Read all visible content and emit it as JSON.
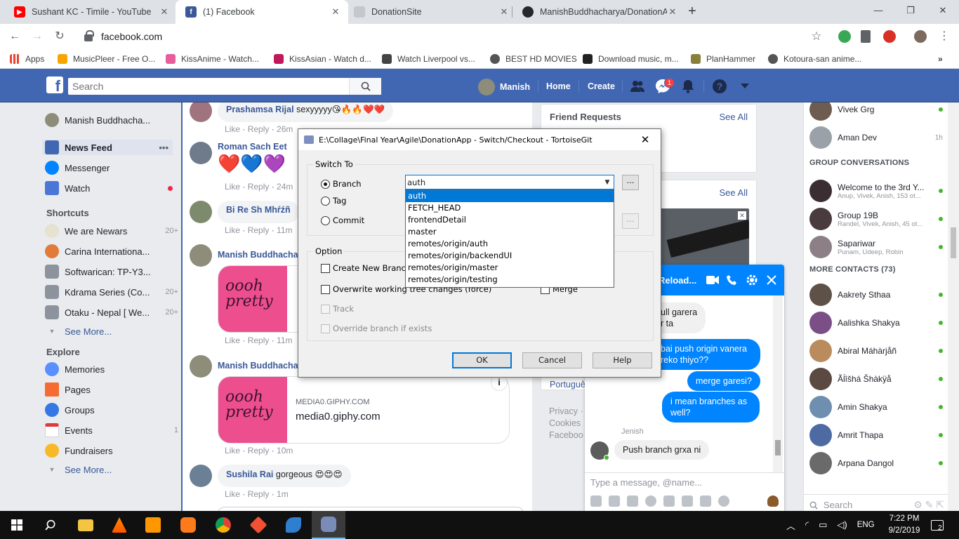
{
  "browser": {
    "tabs": [
      {
        "title": "Sushant KC - Timile - YouTube",
        "favicon_color": "#ff0000"
      },
      {
        "title": "(1) Facebook",
        "favicon_color": "#3b5998"
      },
      {
        "title": "DonationSite",
        "favicon_color": "#9aa0a6"
      },
      {
        "title": "ManishBuddhacharya/DonationA",
        "favicon_color": "#24292e"
      }
    ],
    "url": "facebook.com",
    "bookmarks": [
      "Apps",
      "MusicPleer - Free O...",
      "KissAnime - Watch...",
      "KissAsian - Watch d...",
      "Watch Liverpool vs...",
      "BEST HD MOVIES",
      "Download music, m...",
      "PlanHammer",
      "Kotoura-san anime..."
    ]
  },
  "fb_header": {
    "search_placeholder": "Search",
    "user_name": "Manish",
    "home": "Home",
    "create": "Create",
    "messages_badge": "1"
  },
  "left_nav": {
    "profile": "Manish Buddhacha...",
    "main": [
      {
        "label": "News Feed",
        "icon": "news-feed-icon"
      },
      {
        "label": "Messenger",
        "icon": "messenger-icon"
      },
      {
        "label": "Watch",
        "icon": "watch-icon"
      }
    ],
    "shortcuts_title": "Shortcuts",
    "shortcuts": [
      {
        "label": "We are Newars",
        "count": "20+"
      },
      {
        "label": "Carina Internationa...",
        "count": ""
      },
      {
        "label": "Softwarican: TP-Y3...",
        "count": ""
      },
      {
        "label": "Kdrama Series (Co...",
        "count": "20+"
      },
      {
        "label": "Otaku - Nepal [ We...",
        "count": "20+"
      }
    ],
    "see_more": "See More...",
    "explore_title": "Explore",
    "explore": [
      {
        "label": "Memories",
        "count": ""
      },
      {
        "label": "Pages",
        "count": ""
      },
      {
        "label": "Groups",
        "count": ""
      },
      {
        "label": "Events",
        "count": "1"
      },
      {
        "label": "Fundraisers",
        "count": ""
      }
    ],
    "see_more2": "See More..."
  },
  "feed": {
    "c1": {
      "name": "Prashamsa Rijal",
      "text": "sexyyyyy😘🔥🔥❤️❤️",
      "time": "26m"
    },
    "c2": {
      "name": "Roman Sach Eet",
      "text": "❤️💙💜",
      "time": "24m"
    },
    "c3": {
      "name": "Bi Re Sh Mhŕźñ",
      "text": "",
      "time": "11m"
    },
    "c4": {
      "name": "Manish Buddhacha",
      "time": "11m"
    },
    "c5": {
      "name": "Manish Buddhacha",
      "time": "10m"
    },
    "c6": {
      "name": "Sushila Rai",
      "text": "gorgeous 😍😍😍",
      "time": "1m"
    },
    "like": "Like",
    "reply": "Reply",
    "giphy_image_text": "oooh pretty",
    "giphy_domain": "MEDIA0.GIPHY.COM",
    "giphy_title": "media0.giphy.com"
  },
  "right_col": {
    "friend_requests": "Friend Requests",
    "see_all": "See All",
    "see_all2": "See All",
    "portuguese": "Portuguê",
    "footer1": "Privacy ·",
    "footer2": "Cookies",
    "footer3": "Faceboo"
  },
  "chat_sidebar": {
    "top": [
      {
        "name": "Vivek Grg",
        "time": ""
      },
      {
        "name": "Aman Dev",
        "time": "1h"
      }
    ],
    "group_title": "GROUP CONVERSATIONS",
    "groups": [
      {
        "name": "Welcome to the 3rd Y...",
        "sub": "Anup, Vivek, Anish, 153 ot..."
      },
      {
        "name": "Group 19B",
        "sub": "Randel, Vivek, Anish, 45 ot..."
      },
      {
        "name": "Sapariwar",
        "sub": "Punam, Udeep, Robin"
      }
    ],
    "more_title": "MORE CONTACTS (73)",
    "contacts": [
      "Aakrety Sthaa",
      "Aalishka Shakya",
      "Abiral Máhàrjåñ",
      "Ãĺîšhá Šhàkÿå",
      "Amin Shakya",
      "Amrit Thapa",
      "Arpana Dangol"
    ],
    "search": "Search"
  },
  "chat_window": {
    "title": "Reload...",
    "msgs_in_top": "ull garera\nr ta",
    "msg_out1": "bai push origin vanera\nreko thiyo??",
    "msg_out2": "merge garesi?",
    "msg_out3": "i mean branches as\nwell?",
    "sender": "Jenish",
    "msg_in2": "Push branch grxa ni",
    "input_placeholder": "Type a message, @name..."
  },
  "dialog": {
    "title": "E:\\Collage\\Final Year\\Agile\\DonationApp - Switch/Checkout - TortoiseGit",
    "switch_to": "Switch To",
    "branch": "Branch",
    "tag": "Tag",
    "commit": "Commit",
    "selected_branch": "auth",
    "branches": [
      "auth",
      "FETCH_HEAD",
      "frontendDetail",
      "master",
      "remotes/origin/auth",
      "remotes/origin/backendUI",
      "remotes/origin/master",
      "remotes/origin/testing"
    ],
    "option": "Option",
    "create_new_branch": "Create New Branch",
    "overwrite": "Overwrite working tree changes (force)",
    "merge": "Merge",
    "track": "Track",
    "override": "Override branch if exists",
    "ok": "OK",
    "cancel": "Cancel",
    "help": "Help",
    "browse": "..."
  },
  "taskbar": {
    "lang": "ENG",
    "time": "7:22 PM",
    "date": "9/2/2019",
    "notif": "2"
  }
}
